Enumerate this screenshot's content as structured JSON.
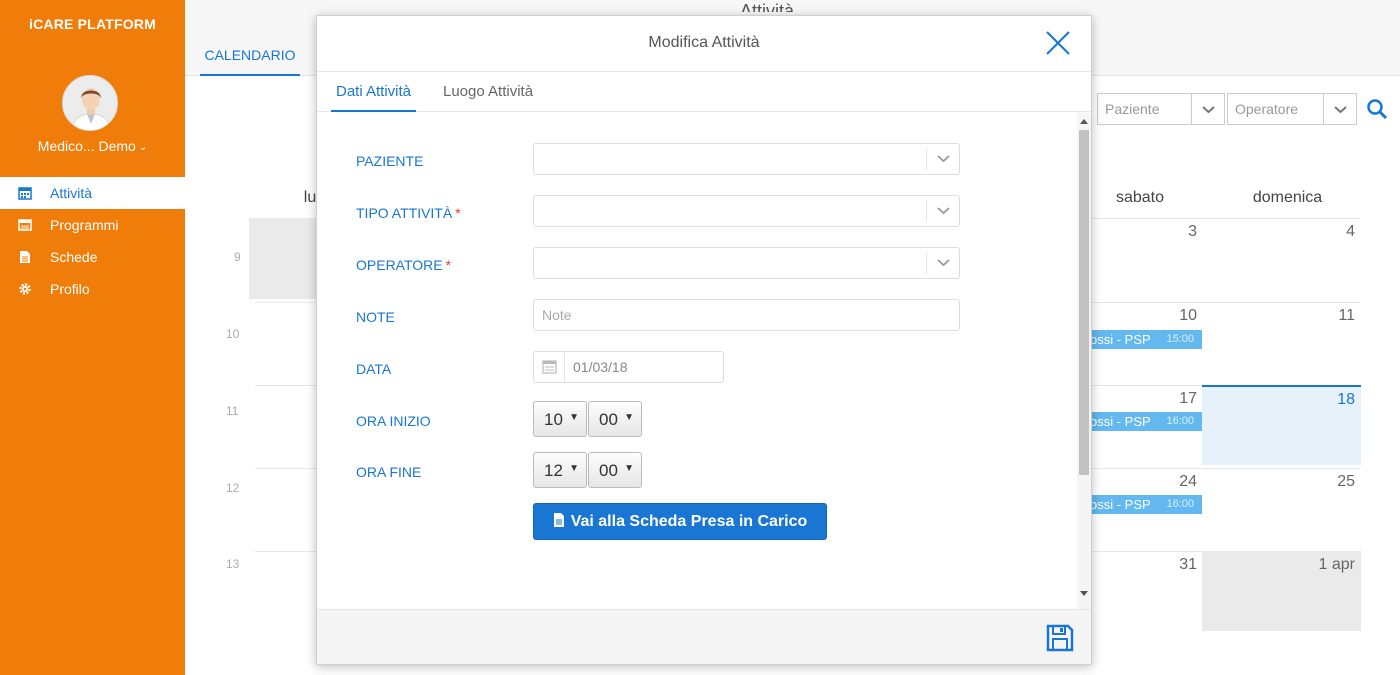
{
  "app": {
    "brand": "iCARE PLATFORM"
  },
  "user": {
    "name": "Medico... Demo"
  },
  "sidebar": {
    "items": [
      {
        "label": "Attività",
        "icon": "calendar-icon",
        "active": true
      },
      {
        "label": "Programmi",
        "icon": "list-icon"
      },
      {
        "label": "Schede",
        "icon": "document-icon"
      },
      {
        "label": "Profilo",
        "icon": "gear-icon"
      }
    ]
  },
  "page": {
    "title": "Attività",
    "tab": "CALENDARIO"
  },
  "filters": {
    "patient_placeholder": "Paziente",
    "operator_placeholder": "Operatore"
  },
  "calendar": {
    "day_headers": [
      "lu",
      "sabato",
      "domenica"
    ],
    "row_labels": [
      "9",
      "10",
      "11",
      "12",
      "13"
    ],
    "saturday_dates": [
      "3",
      "10",
      "17",
      "24",
      "31"
    ],
    "sunday_dates": [
      "4",
      "11",
      "18",
      "25",
      "1 apr"
    ],
    "events": [
      {
        "text": "ossi - PSP",
        "time": "15:00"
      },
      {
        "text": "ossi - PSP",
        "time": "16:00"
      },
      {
        "text": "ossi - PSP",
        "time": "16:00"
      }
    ]
  },
  "modal": {
    "title": "Modifica Attività",
    "tabs": [
      "Dati Attività",
      "Luogo Attività"
    ],
    "fields": {
      "patient": "PAZIENTE",
      "activity_type": "TIPO ATTIVITÀ",
      "operator": "OPERATORE",
      "note": "NOTE",
      "note_placeholder": "Note",
      "date": "DATA",
      "date_value": "01/03/18",
      "start_time": "ORA INIZIO",
      "start_hour": "10",
      "start_min": "00",
      "end_time": "ORA FINE",
      "end_hour": "12",
      "end_min": "00",
      "required_mark": "*"
    },
    "button": "Vai alla Scheda Presa in Carico"
  },
  "colors": {
    "sidebar": "#F07D0A",
    "accent": "#1976D2",
    "event": "#63B8EF",
    "required": "#E53935"
  }
}
